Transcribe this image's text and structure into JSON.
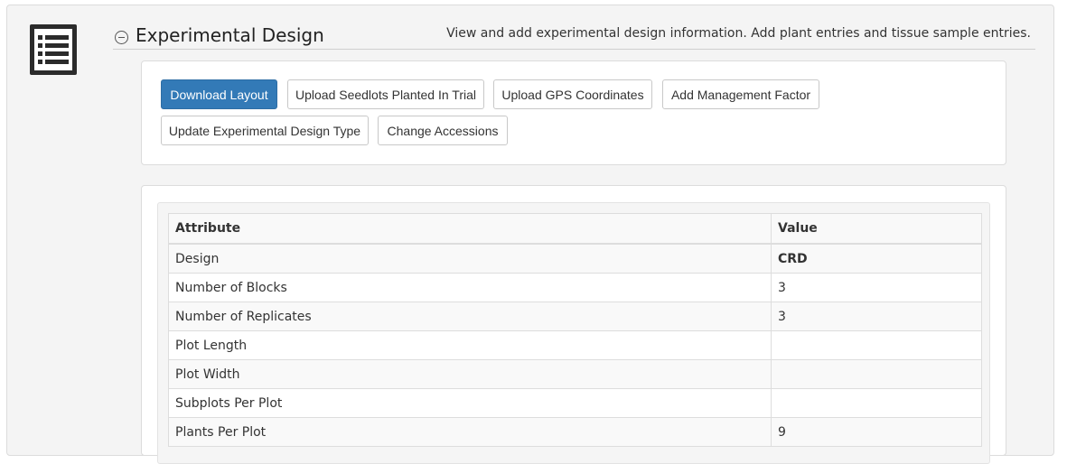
{
  "section": {
    "title": "Experimental Design",
    "description": "View and add experimental design information. Add plant entries and tissue sample entries."
  },
  "buttons": {
    "download_layout": "Download Layout",
    "upload_seedlots": "Upload Seedlots Planted In Trial",
    "upload_gps": "Upload GPS Coordinates",
    "add_management_factor": "Add Management Factor",
    "update_design_type": "Update Experimental Design Type",
    "change_accessions": "Change Accessions"
  },
  "table": {
    "headers": [
      "Attribute",
      "Value"
    ],
    "rows": [
      {
        "attribute": "Design",
        "value": "CRD"
      },
      {
        "attribute": "Number of Blocks",
        "value": "3"
      },
      {
        "attribute": "Number of Replicates",
        "value": "3"
      },
      {
        "attribute": "Plot Length",
        "value": ""
      },
      {
        "attribute": "Plot Width",
        "value": ""
      },
      {
        "attribute": "Subplots Per Plot",
        "value": ""
      },
      {
        "attribute": "Plants Per Plot",
        "value": "9"
      }
    ]
  },
  "colors": {
    "primary_button": "#337ab7",
    "panel_background": "#f4f4f4"
  },
  "icons": {
    "section_icon": "list-icon",
    "collapse_icon": "collapse-minus-icon"
  }
}
